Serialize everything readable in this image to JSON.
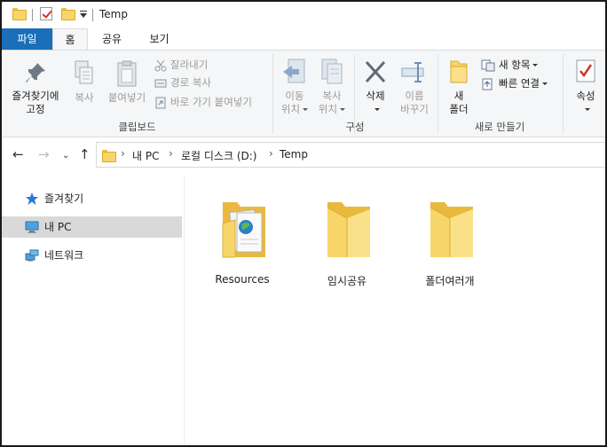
{
  "window": {
    "title": "Temp"
  },
  "tabs": [
    {
      "id": "file",
      "label": "파일"
    },
    {
      "id": "home",
      "label": "홈"
    },
    {
      "id": "share",
      "label": "공유"
    },
    {
      "id": "view",
      "label": "보기"
    }
  ],
  "ribbon": {
    "clipboard": {
      "group_label": "클립보드",
      "pin_label_1": "즐겨찾기에",
      "pin_label_2": "고정",
      "copy_label": "복사",
      "paste_label": "붙여넣기",
      "cut_label": "잘라내기",
      "copy_path_label": "경로 복사",
      "paste_shortcut_label": "바로 가기 붙여넣기"
    },
    "organize": {
      "group_label": "구성",
      "move_label_1": "이동",
      "move_label_2": "위치",
      "copyto_label_1": "복사",
      "copyto_label_2": "위치",
      "delete_label": "삭제",
      "rename_label_1": "이름",
      "rename_label_2": "바꾸기"
    },
    "new": {
      "group_label": "새로 만들기",
      "new_folder_label_1": "새",
      "new_folder_label_2": "폴더",
      "new_item_label": "새 항목",
      "easy_access_label": "빠른 연결"
    },
    "open": {
      "properties_label": "속성"
    }
  },
  "address": {
    "crumbs": [
      "내 PC",
      "로컬 디스크 (D:)",
      "Temp"
    ]
  },
  "sidebar": {
    "items": [
      {
        "label": "즐겨찾기",
        "icon": "star-icon"
      },
      {
        "label": "내 PC",
        "icon": "computer-icon"
      },
      {
        "label": "네트워크",
        "icon": "network-icon"
      }
    ]
  },
  "files": [
    {
      "name": "Resources",
      "icon": "folder-with-files-icon"
    },
    {
      "name": "임시공유",
      "icon": "folder-icon"
    },
    {
      "name": "폴더여러개",
      "icon": "folder-icon"
    }
  ],
  "colors": {
    "accent": "#1a6fb8",
    "folder": "#f8d568",
    "selection": "#d9d9d9"
  }
}
